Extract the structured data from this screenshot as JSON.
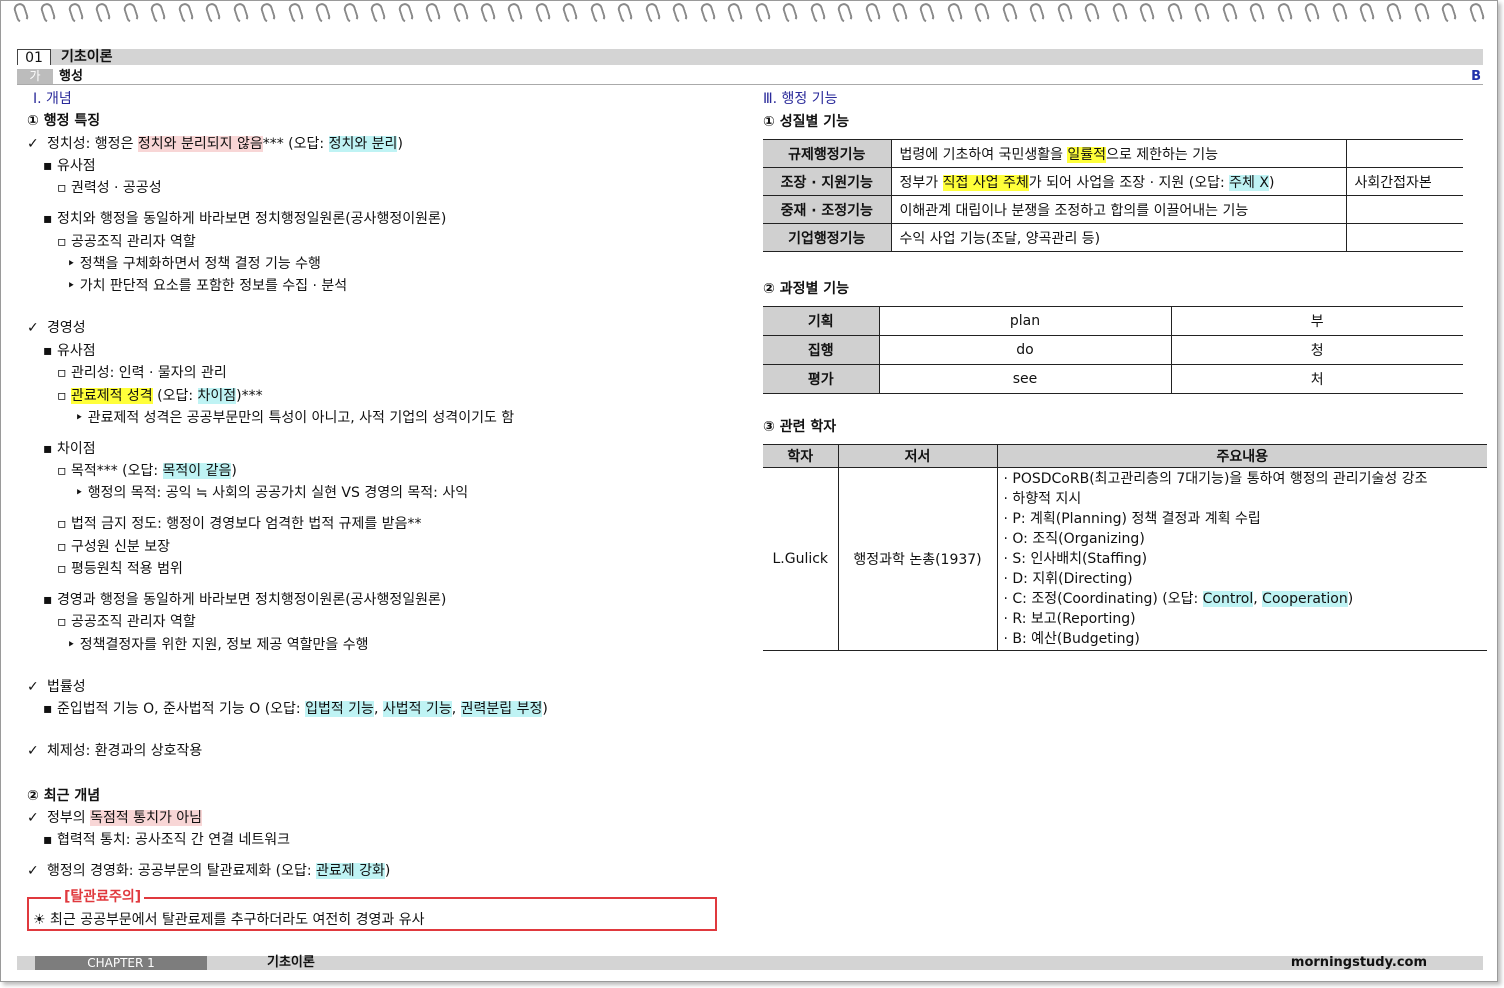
{
  "header": {
    "chapter_num": "01",
    "chapter_title": "기초이론",
    "section_mark": "가",
    "section_title": "행성",
    "grade": "B"
  },
  "left": {
    "sec1": "Ⅰ. 개념",
    "h1": "① 행정 특징",
    "l1": [
      "정치성: 행정은 ",
      "정치와 분리되지 않음",
      "*** (오답: ",
      "정치와 분리",
      ")"
    ],
    "l2": "▪ 유사점",
    "l3": "▫ 권력성 · 공공성",
    "l4": "▪ 정치와 행정을 동일하게 바라보면 정치행정일원론(공사행정이원론)",
    "l5": "▫ 공공조직 관리자 역할",
    "l6": "‣ 정책을 구체화하면서 정책 결정 기능 수행",
    "l7": "‣ 가치 판단적 요소를 포함한 정보를 수집 · 분석",
    "l8": "경영성",
    "l9": "▪ 유사점",
    "l10": "▫ 관리성: 인력 · 물자의 관리",
    "l11": [
      "▫ ",
      "관료제적 성격",
      " (오답: ",
      "차이점",
      ")***"
    ],
    "l12": "‣ 관료제적 성격은 공공부문만의 특성이 아니고, 사적 기업의 성격이기도 함",
    "l13": "▪ 차이점",
    "l14": [
      "▫ 목적*** (오답: ",
      "목적이 같음",
      ")"
    ],
    "l15": "‣ 행정의 목적: 공익 ≒ 사회의 공공가치 실현   VS 경영의 목적: 사익",
    "l16": "▫ 법적 금지 정도: 행정이 경영보다 엄격한 법적 규제를 받음**",
    "l17": "▫ 구성원 신분 보장",
    "l18": "▫ 평등원칙 적용 범위",
    "l19": "▪ 경영과 행정을 동일하게 바라보면 정치행정이원론(공사행정일원론)",
    "l20": "▫ 공공조직 관리자 역할",
    "l21": "‣ 정책결정자를 위한 지원, 정보 제공 역할만을 수행",
    "l22": "법률성",
    "l23": [
      "▪ 준입법적 기능 O, 준사법적 기능 O (오답: ",
      "입법적 기능",
      ", ",
      "사법적 기능",
      ", ",
      "권력분립 부정",
      ")"
    ],
    "l24": "체제성: 환경과의 상호작용",
    "h2": "② 최근 개념",
    "l25": [
      "정부의 ",
      "독점적 통치가 아님"
    ],
    "l26": "▪ 협력적 통치: 공사조직 간 연결 네트워크",
    "l27": [
      "행정의 경영화: 공공부문의 탈관료제화 (오답: ",
      "관료제 강화",
      ")"
    ],
    "warn_label": "[탈관료주의]",
    "warn_text": "☀ 최근 공공부문에서 탈관료제를 추구하더라도 여전히 경영과 유사"
  },
  "right": {
    "sec3": "Ⅲ. 행정 기능",
    "h1": "① 성질별 기능",
    "t1": [
      {
        "name": "규제행정기능",
        "desc": [
          "법령에 기초하여 국민생활을 ",
          "일률적",
          "으로 제한하는 기능"
        ],
        "note": ""
      },
      {
        "name": "조장 · 지원기능",
        "desc": [
          "정부가 ",
          "직접 사업 주체",
          "가 되어 사업을 조장 · 지원 (오답: ",
          "주체 X",
          ")"
        ],
        "note": "사회간접자본"
      },
      {
        "name": "중재 · 조정기능",
        "desc": [
          "이해관계 대립이나 분쟁을 조정하고 합의를 이끌어내는 기능"
        ],
        "note": ""
      },
      {
        "name": "기업행정기능",
        "desc": [
          "수익 사업 기능(조달, 양곡관리 등)"
        ],
        "note": ""
      }
    ],
    "h2": "② 과정별 기능",
    "t2": [
      {
        "name": "기획",
        "en": "plan",
        "kr": "부"
      },
      {
        "name": "집행",
        "en": "do",
        "kr": "청"
      },
      {
        "name": "평가",
        "en": "see",
        "kr": "처"
      }
    ],
    "h3": "③ 관련 학자",
    "t3": {
      "headers": [
        "학자",
        "저서",
        "주요내용"
      ],
      "scholar": "L.Gulick",
      "book": "행정과학 논총(1937)",
      "items": [
        "· POSDCoRB(최고관리층의 7대기능)을 통하여 행정의 관리기술성 강조",
        "· 하향적 지시",
        "   · P: 계획(Planning) 정책 결정과 계획 수립",
        "   · O: 조직(Organizing)",
        "   · S: 인사배치(Staffing)",
        "   · D: 지휘(Directing)",
        "   · R: 보고(Reporting)",
        "   · B: 예산(Budgeting)"
      ],
      "c_item": [
        "   · C: 조정(Coordinating) (오답: ",
        "Control",
        ", ",
        "Cooperation",
        ")"
      ]
    }
  },
  "footer": {
    "chapter": "CHAPTER 1",
    "title": "기초이론",
    "site": "morningstudy.com"
  }
}
